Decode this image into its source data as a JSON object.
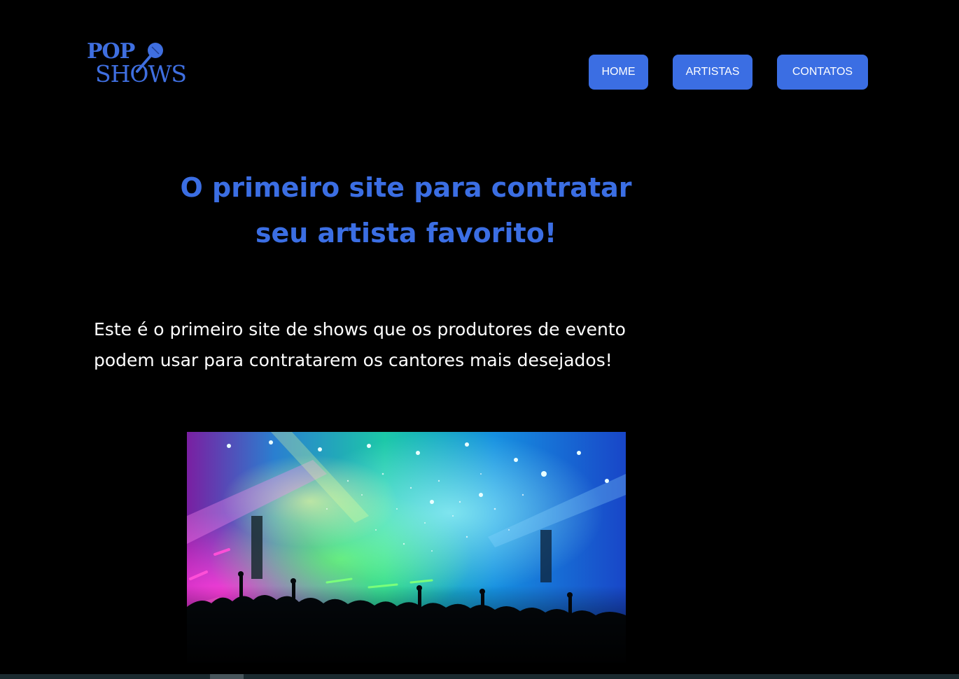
{
  "header": {
    "logo": {
      "line1": "POP",
      "line2": "SHOWS",
      "icon": "microphone-icon",
      "color": "#3f6fe0"
    },
    "nav": [
      {
        "label": "HOME"
      },
      {
        "label": "ARTISTAS"
      },
      {
        "label": "CONTATOS"
      }
    ],
    "nav_color": "#3b6ee3"
  },
  "hero": {
    "title_line1": "O primeiro site para contratar",
    "title_line2": "seu artista favorito!",
    "description_line1": "Este é o primeiro site de shows que os produtores de evento",
    "description_line2": "podem usar para contratarem os cantores mais desejados!",
    "image": "concert-crowd-image"
  },
  "colors": {
    "background": "#000000",
    "accent": "#3b6ee3",
    "text": "#ffffff"
  }
}
